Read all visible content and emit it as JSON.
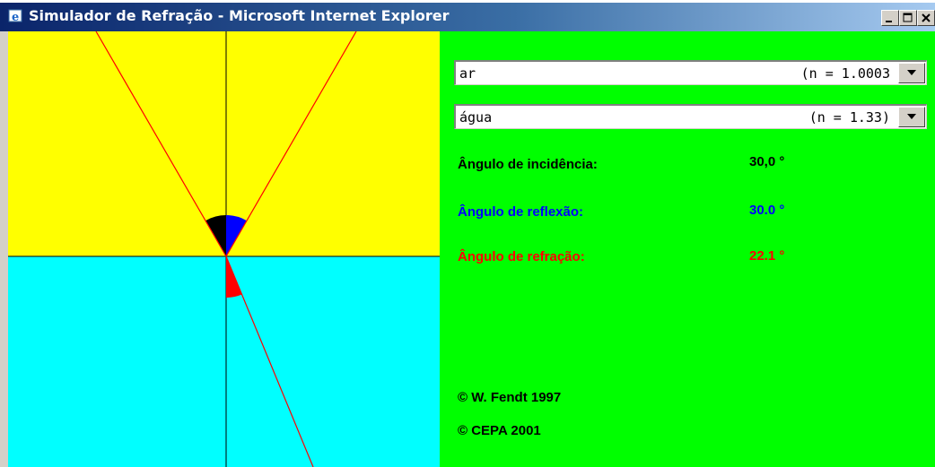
{
  "window": {
    "title": "Simulador de Refração - Microsoft Internet Explorer",
    "app_icon": "internet-explorer-icon",
    "buttons": [
      "minimize-icon",
      "maximize-icon",
      "close-icon"
    ]
  },
  "simulation": {
    "colors": {
      "upper_medium": "#ffff00",
      "lower_medium": "#00ffff",
      "ray": "#ff0000",
      "incidence_arc": "#000000",
      "reflection_arc": "#0000ff",
      "refraction_arc": "#ff0000"
    },
    "angle_incidence_deg": 30.0,
    "angle_reflection_deg": 30.0,
    "angle_refraction_deg": 22.1
  },
  "controls": {
    "medium1": {
      "value": "ar",
      "index": "(n = 1.0003"
    },
    "medium2": {
      "value": "água",
      "index": "(n = 1.33)"
    }
  },
  "readouts": {
    "incidence": {
      "label": "Ângulo de incidência:",
      "value": "30,0 °",
      "color": "#000000"
    },
    "reflection": {
      "label": "Ângulo de reflexão:",
      "value": "30.0 °",
      "color": "#0000ff"
    },
    "refraction": {
      "label": "Ângulo de refração:",
      "value": "22.1 °",
      "color": "#ff0000"
    }
  },
  "credits": [
    "© W. Fendt 1997",
    "© CEPA 2001"
  ],
  "panel_color": "#00ff00"
}
